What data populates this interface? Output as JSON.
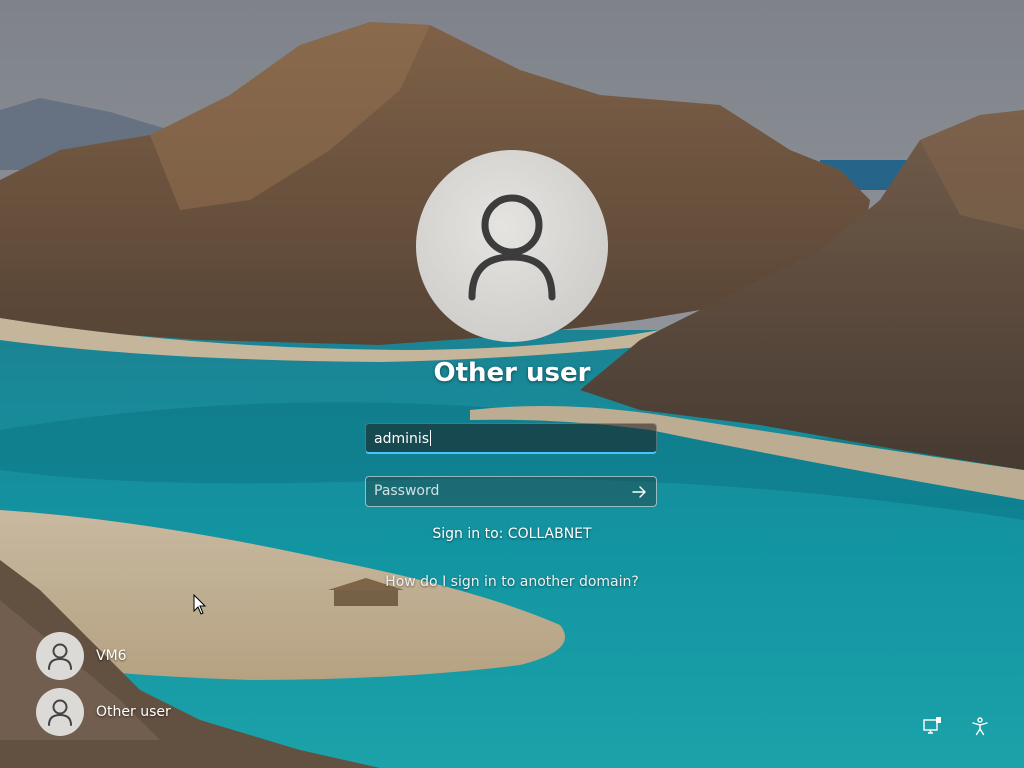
{
  "login": {
    "user_name": "Other user",
    "username_value": "adminis",
    "password_placeholder": "Password",
    "sign_in_to": "Sign in to: COLLABNET",
    "domain_help_link": "How do I sign in to another domain?"
  },
  "user_list": [
    {
      "label": "VM6",
      "icon": "person-icon"
    },
    {
      "label": "Other user",
      "icon": "person-icon"
    }
  ],
  "tray": {
    "network_icon": "network-icon",
    "accessibility_icon": "accessibility-icon"
  },
  "colors": {
    "focus_accent": "#4cc2ff",
    "text": "#ffffff"
  }
}
